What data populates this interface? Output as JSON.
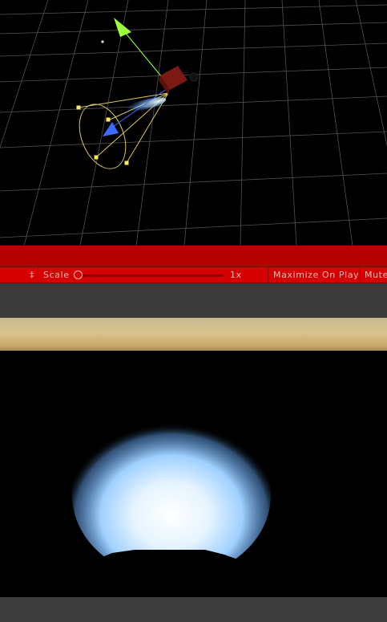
{
  "toolbar": {
    "aspect_label": "‡",
    "scale_label": "Scale",
    "scale_value": "1x",
    "scale_fraction": 0.0,
    "maximize_label": "Maximize On Play",
    "mute_label": "Mute"
  },
  "colors": {
    "toolbar_bg": "#d60000",
    "red_band": "#b50000",
    "toolbar_text": "#ffb8b8",
    "gizmo_y_axis": "#9bff3c",
    "gizmo_z_axis": "#3c6cff",
    "cone_outline": "#d8c860",
    "light_glow": "#bfe6ff"
  },
  "icons": {
    "scene_light_icon": "spot-light-gizmo",
    "move_handle_y": "arrow-y-icon",
    "move_handle_z": "arrow-z-icon",
    "center_cube": "cube-icon"
  }
}
